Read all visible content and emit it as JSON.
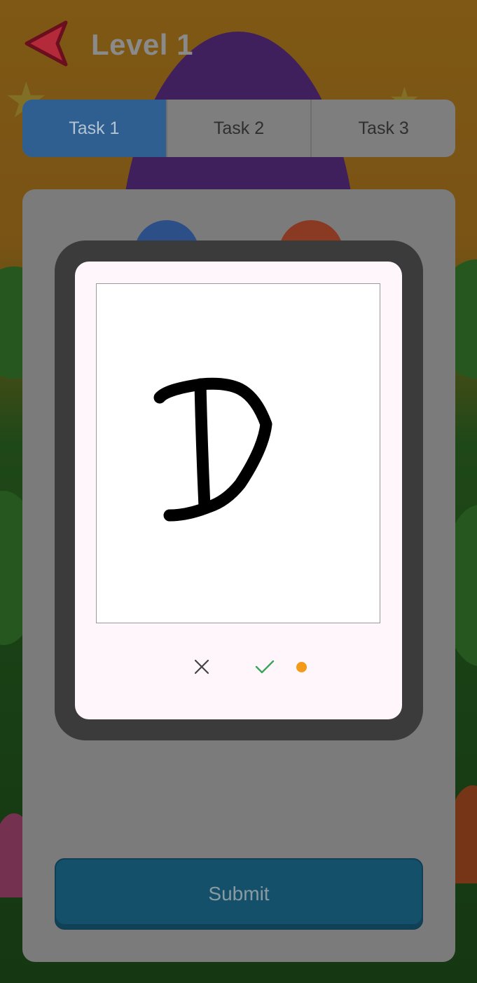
{
  "header": {
    "title": "Level 1",
    "back_icon": "back-arrow-icon"
  },
  "tabs": [
    {
      "label": "Task 1",
      "active": true
    },
    {
      "label": "Task 2",
      "active": false
    },
    {
      "label": "Task 3",
      "active": false
    }
  ],
  "panel": {
    "audio_buttons": [
      "speaker-icon",
      "voice-icon"
    ]
  },
  "drawing_dialog": {
    "clear_icon": "close-icon",
    "confirm_icon": "check-icon",
    "status_dot_color": "#f39a19"
  },
  "submit": {
    "label": "Submit"
  },
  "colors": {
    "active_tab": "#2f5f91",
    "back_arrow": "#c41e3a",
    "submit": "#15506a"
  }
}
